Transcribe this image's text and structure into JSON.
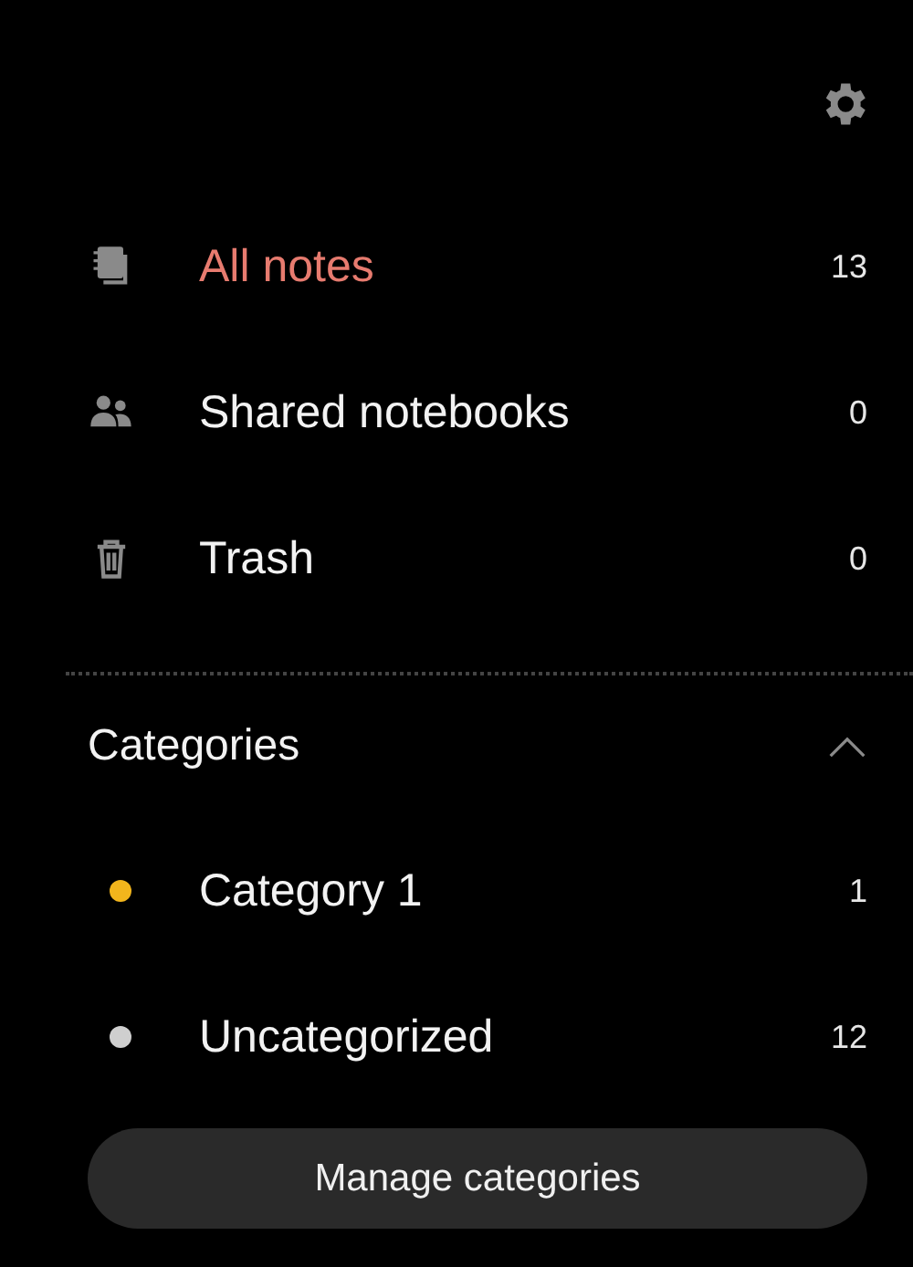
{
  "nav_items": [
    {
      "kind": "notes",
      "label": "All notes",
      "count": "13",
      "selected": true
    },
    {
      "kind": "shared",
      "label": "Shared notebooks",
      "count": "0",
      "selected": false
    },
    {
      "kind": "trash",
      "label": "Trash",
      "count": "0",
      "selected": false
    }
  ],
  "categories": {
    "title": "Categories",
    "expanded": true,
    "items": [
      {
        "label": "Category 1",
        "count": "1",
        "color": "#f2b51c"
      },
      {
        "label": "Uncategorized",
        "count": "12",
        "color": "#cfcfcf"
      }
    ]
  },
  "manage_button": "Manage categories"
}
